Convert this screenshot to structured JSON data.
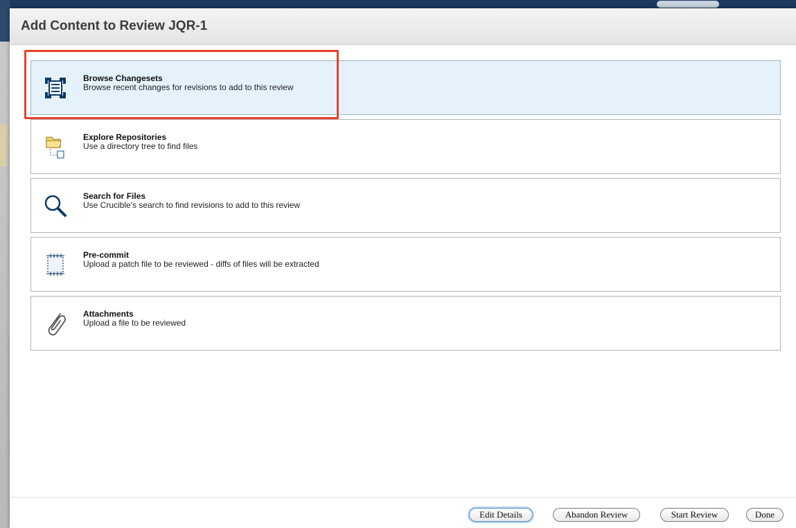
{
  "dialog": {
    "title": "Add Content to Review JQR-1"
  },
  "options": [
    {
      "icon": "changeset-icon",
      "title": "Browse Changesets",
      "description": "Browse recent changes for revisions to add to this review"
    },
    {
      "icon": "folder-icon",
      "title": "Explore Repositories",
      "description": "Use a directory tree to find files"
    },
    {
      "icon": "magnifier-icon",
      "title": "Search for Files",
      "description": "Use Crucible's search to find revisions to add to this review"
    },
    {
      "icon": "patch-icon",
      "title": "Pre-commit",
      "description": "Upload a patch file to be reviewed - diffs of files will be extracted"
    },
    {
      "icon": "paperclip-icon",
      "title": "Attachments",
      "description": "Upload a file to be reviewed"
    }
  ],
  "footer": {
    "edit_details": "Edit Details",
    "abandon_review": "Abandon Review",
    "start_review": "Start Review",
    "done": "Done"
  },
  "colors": {
    "highlight": "#e8402c",
    "selected_bg": "#e6f2fb"
  }
}
